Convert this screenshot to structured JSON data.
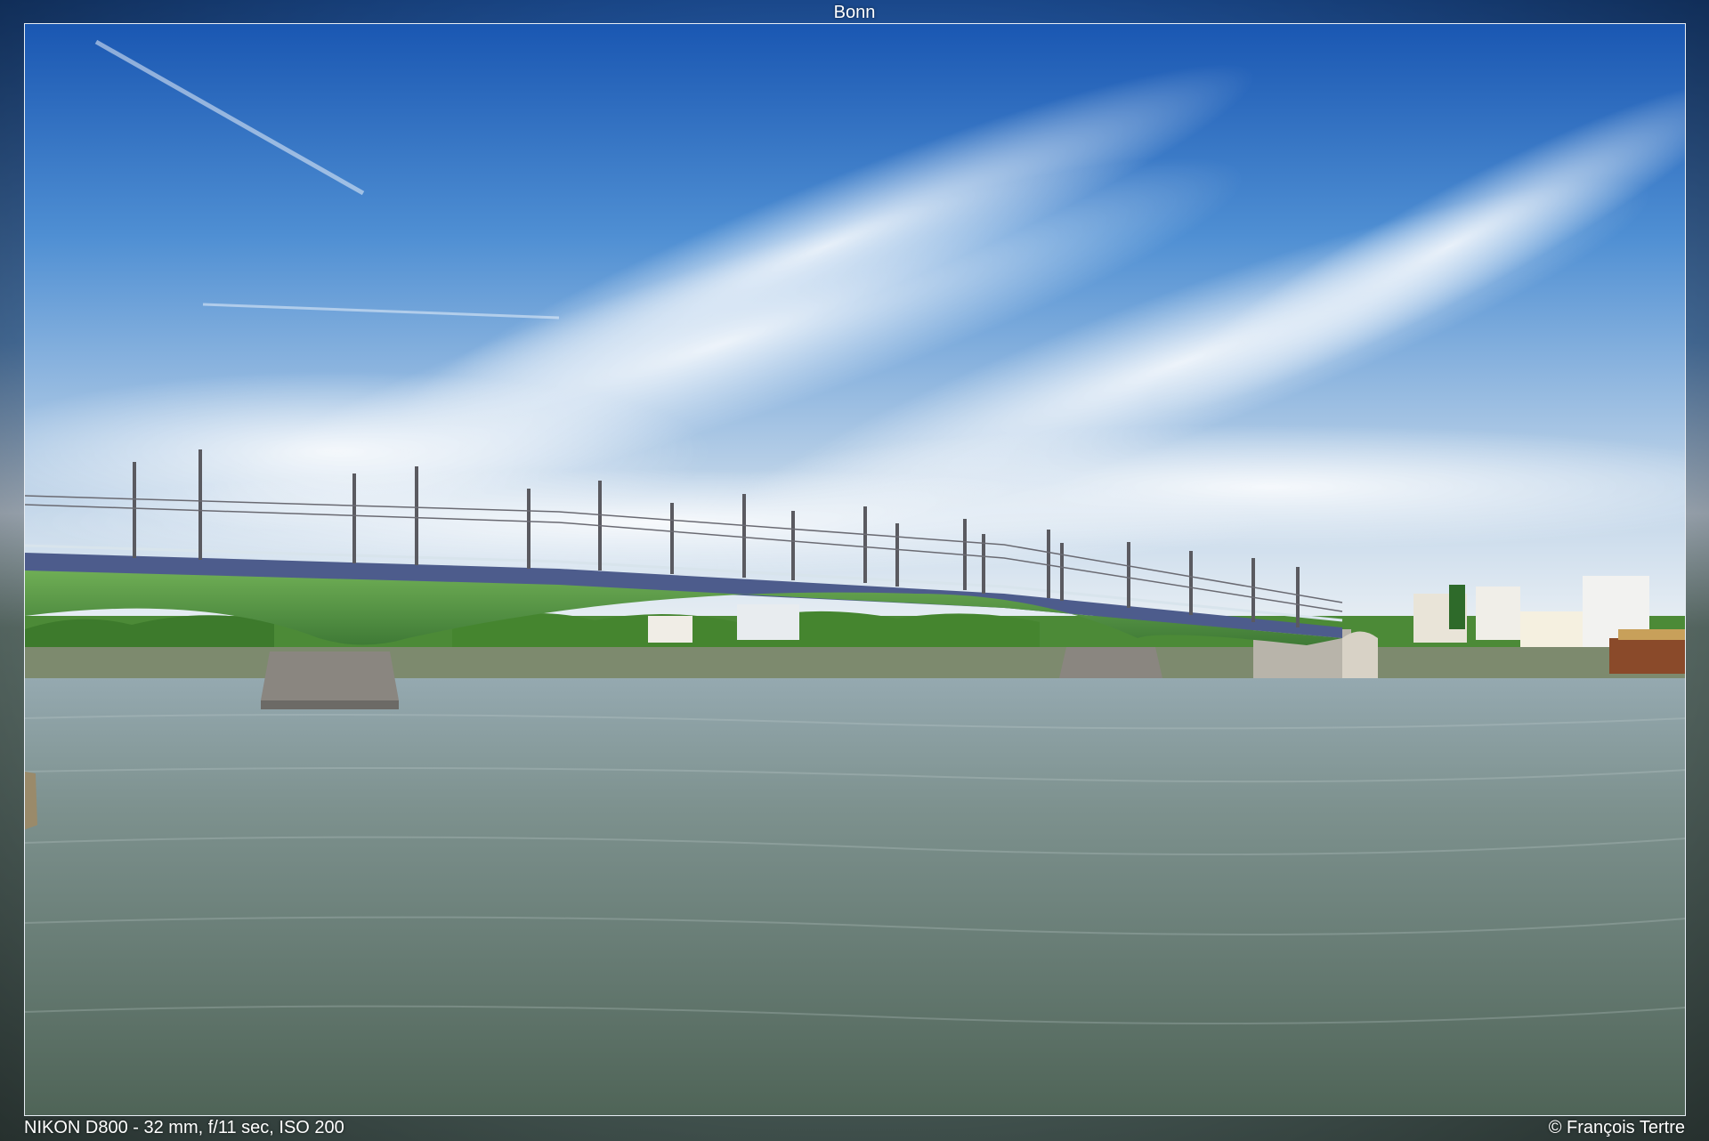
{
  "title": "Bonn",
  "exif": "NIKON D800 - 32 mm, f/11 sec, ISO 200",
  "copyright": "© François Tertre",
  "colors": {
    "sky_top": "#1f5fb8",
    "sky_mid": "#5d9ad6",
    "sky_horizon": "#dfe8f0",
    "bridge_green": "#5d9a4a",
    "bridge_deck": "#4a5a8a",
    "water_top": "#8fa3a6",
    "water_bottom": "#5b6f62",
    "trees": "#3f7a2e"
  }
}
